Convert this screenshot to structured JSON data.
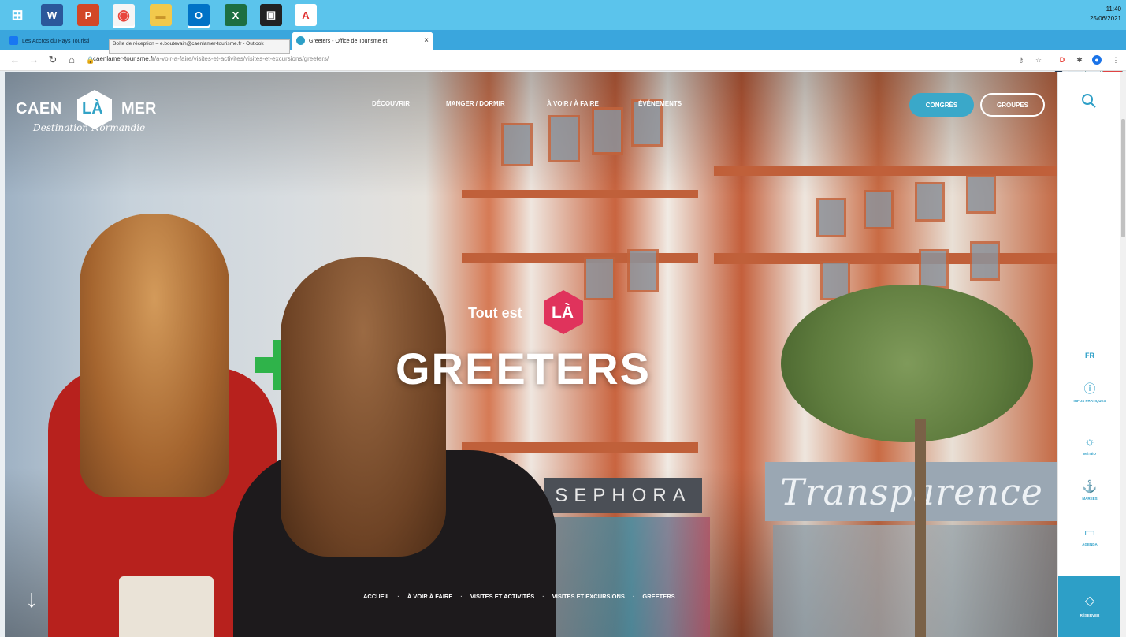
{
  "taskbar": {
    "apps": [
      {
        "name": "windows-start",
        "glyph": "⊞",
        "color": "#5bc4ec"
      },
      {
        "name": "word",
        "glyph": "W",
        "color": "#2b579a"
      },
      {
        "name": "powerpoint",
        "glyph": "P",
        "color": "#d24726"
      },
      {
        "name": "chrome",
        "glyph": "◉",
        "color": "#e8453c"
      },
      {
        "name": "file-explorer",
        "glyph": "▬",
        "color": "#f2c94c"
      },
      {
        "name": "outlook",
        "glyph": "O",
        "color": "#0072c6"
      },
      {
        "name": "excel",
        "glyph": "X",
        "color": "#1d6f42"
      },
      {
        "name": "app-black",
        "glyph": "▣",
        "color": "#222222"
      },
      {
        "name": "acrobat",
        "glyph": "A",
        "color": "#e03131"
      }
    ],
    "clock_time": "11:40",
    "clock_date": "25/06/2021"
  },
  "browser": {
    "tab1_title": "Les Accros du Pays Touristi",
    "tab2_title": "Greeters - Office de Tourisme et",
    "tooltip": "Boîte de réception – e.boutevain@caenlamer-tourisme.fr - Outlook",
    "new_tab": "+",
    "url_host": "caenlamer-tourisme.fr",
    "url_path": "/a-voir-a-faire/visites-et-activites/visites-et-excursions/greeters/"
  },
  "site": {
    "logo_caen": "CAEN",
    "logo_la": "LÀ",
    "logo_mer": "MER",
    "logo_tagline": "Destination Normandie",
    "nav": [
      "DÉCOUVRIR",
      "MANGER / DORMIR",
      "À VOIR / À FAIRE",
      "ÉVÉNEMENTS"
    ],
    "btn_congres": "CONGRÈS",
    "btn_groupes": "GROUPES",
    "hero_tout_est": "Tout est",
    "hero_la": "LÀ",
    "hero_title": "GREETERS",
    "breadcrumb": [
      "ACCUEIL",
      "À VOIR À FAIRE",
      "VISITES ET ACTIVITÉS",
      "VISITES ET EXCURSIONS",
      "GREETERS"
    ],
    "scroll_arrow": "↓",
    "shop_sign_1": "SEPHORA",
    "shop_sign_2": "Transparence"
  },
  "sidebar": {
    "lang": "FR",
    "items": [
      {
        "icon": "ⓘ",
        "label": "INFOS PRATIQUES"
      },
      {
        "icon": "☼",
        "label": "MÉTÉO"
      },
      {
        "icon": "⚓",
        "label": "MARÉES"
      },
      {
        "icon": "▭",
        "label": "AGENDA"
      }
    ],
    "bottom_icon": "◇",
    "bottom_label": "RÉSERVER"
  },
  "colors": {
    "accent": "#2d9fc7",
    "hero_badge": "#e0335c",
    "taskbar": "#5bc4ec"
  }
}
